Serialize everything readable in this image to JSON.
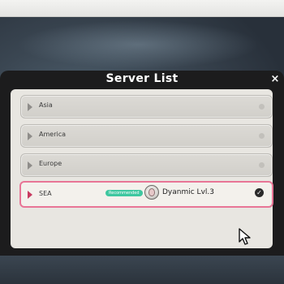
{
  "dialog": {
    "title": "Server List",
    "close_label": "×"
  },
  "servers": [
    {
      "name": "Asia"
    },
    {
      "name": "America"
    },
    {
      "name": "Europe"
    },
    {
      "name": "SEA",
      "selected": true,
      "badge": "Recommended",
      "player_name": "Dyanmic",
      "player_level": "Lvl.3",
      "player_label": "Dyanmic  Lvl.3",
      "check_label": "✓"
    }
  ],
  "colors": {
    "highlight_border": "#e87596",
    "badge": "#3ec7a0",
    "dialog_bg": "#1c1c1d",
    "panel_bg": "#e8e6e1"
  },
  "icons": {
    "close": "close-icon",
    "row_arrow": "play-triangle-icon",
    "selected_check": "check-circle-icon",
    "avatar": "player-avatar",
    "cursor": "mouse-pointer-icon"
  }
}
